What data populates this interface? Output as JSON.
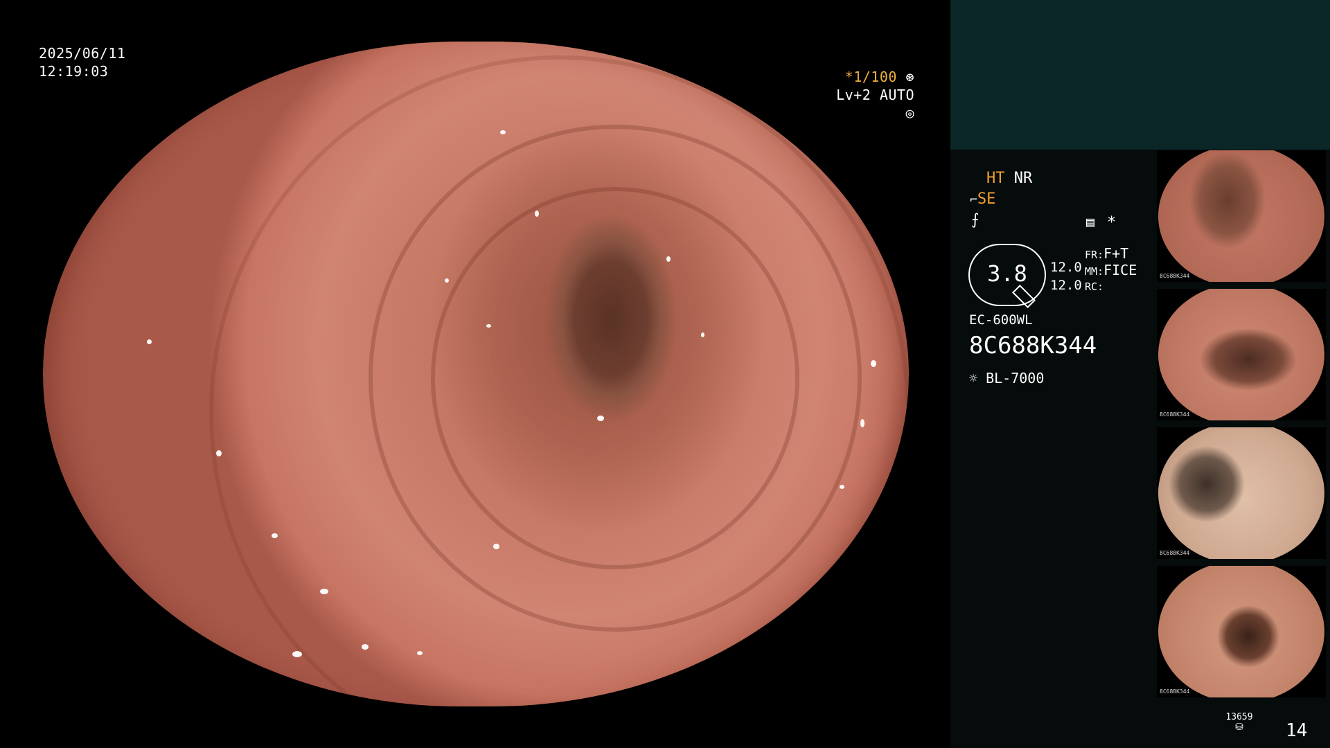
{
  "main": {
    "date": "2025/06/11",
    "time": "12:19:03",
    "shutter": "*1/100",
    "level": "Lv+2 AUTO",
    "shutter_icon": "aperture-icon",
    "level_icon": "iris-icon"
  },
  "panel": {
    "ht_label": "HT",
    "nr_label": "NR",
    "se_label": "SE",
    "se_icon": "structure-enhance-icon",
    "edge_icon": "edge-icon",
    "settings_icon": "settings-list-icon",
    "star_label": "*",
    "gauge_value": "3.8",
    "fr_label": "FR:",
    "fr_value": "F+T",
    "mm_label": "MM:",
    "mm_value": "FICE",
    "rc_label": "RC:",
    "value_1": "12.0",
    "value_2": "12.0",
    "scope_model": "EC-600WL",
    "scope_serial": "8C688K344",
    "light_source": "BL-7000",
    "light_icon": "light-bulb-icon",
    "counter": "13659",
    "counter_icon": "storage-icon",
    "page_number": "14"
  },
  "thumbnails": [
    {
      "serial": "8C688K344"
    },
    {
      "serial": "8C688K344"
    },
    {
      "serial": "8C688K344"
    },
    {
      "serial": "8C688K344"
    }
  ],
  "colors": {
    "accent_orange": "#f0a030",
    "panel_top": "#0b2626",
    "panel_bg": "#060c0c"
  }
}
